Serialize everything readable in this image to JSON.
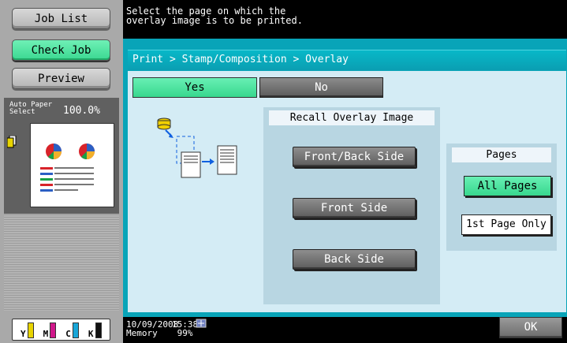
{
  "left": {
    "job_list": "Job List",
    "check_job": "Check Job",
    "preview": "Preview",
    "paper_label_1": "Auto Paper",
    "paper_label_2": "Select",
    "zoom": "100.0%",
    "toner": [
      {
        "letter": "Y",
        "color": "#e8d400"
      },
      {
        "letter": "M",
        "color": "#d0178a"
      },
      {
        "letter": "C",
        "color": "#18a6d8"
      },
      {
        "letter": "K",
        "color": "#111111"
      }
    ]
  },
  "message": "Select the page on which the\noverlay image is to be printed.",
  "breadcrumb": "Print > Stamp/Composition > Overlay",
  "toggle": {
    "yes": "Yes",
    "no": "No"
  },
  "recall": {
    "title": "Recall Overlay Image",
    "buttons": [
      "Front/Back Side",
      "Front Side",
      "Back Side"
    ]
  },
  "pages": {
    "title": "Pages",
    "all": "All Pages",
    "first": "1st Page Only"
  },
  "status": {
    "date": "10/09/2008\nMemory",
    "time": "15:38\n 99%"
  },
  "ok": "OK",
  "colors": {
    "accent_green": "#3ad891",
    "panel_teal": "#08a4b8"
  }
}
